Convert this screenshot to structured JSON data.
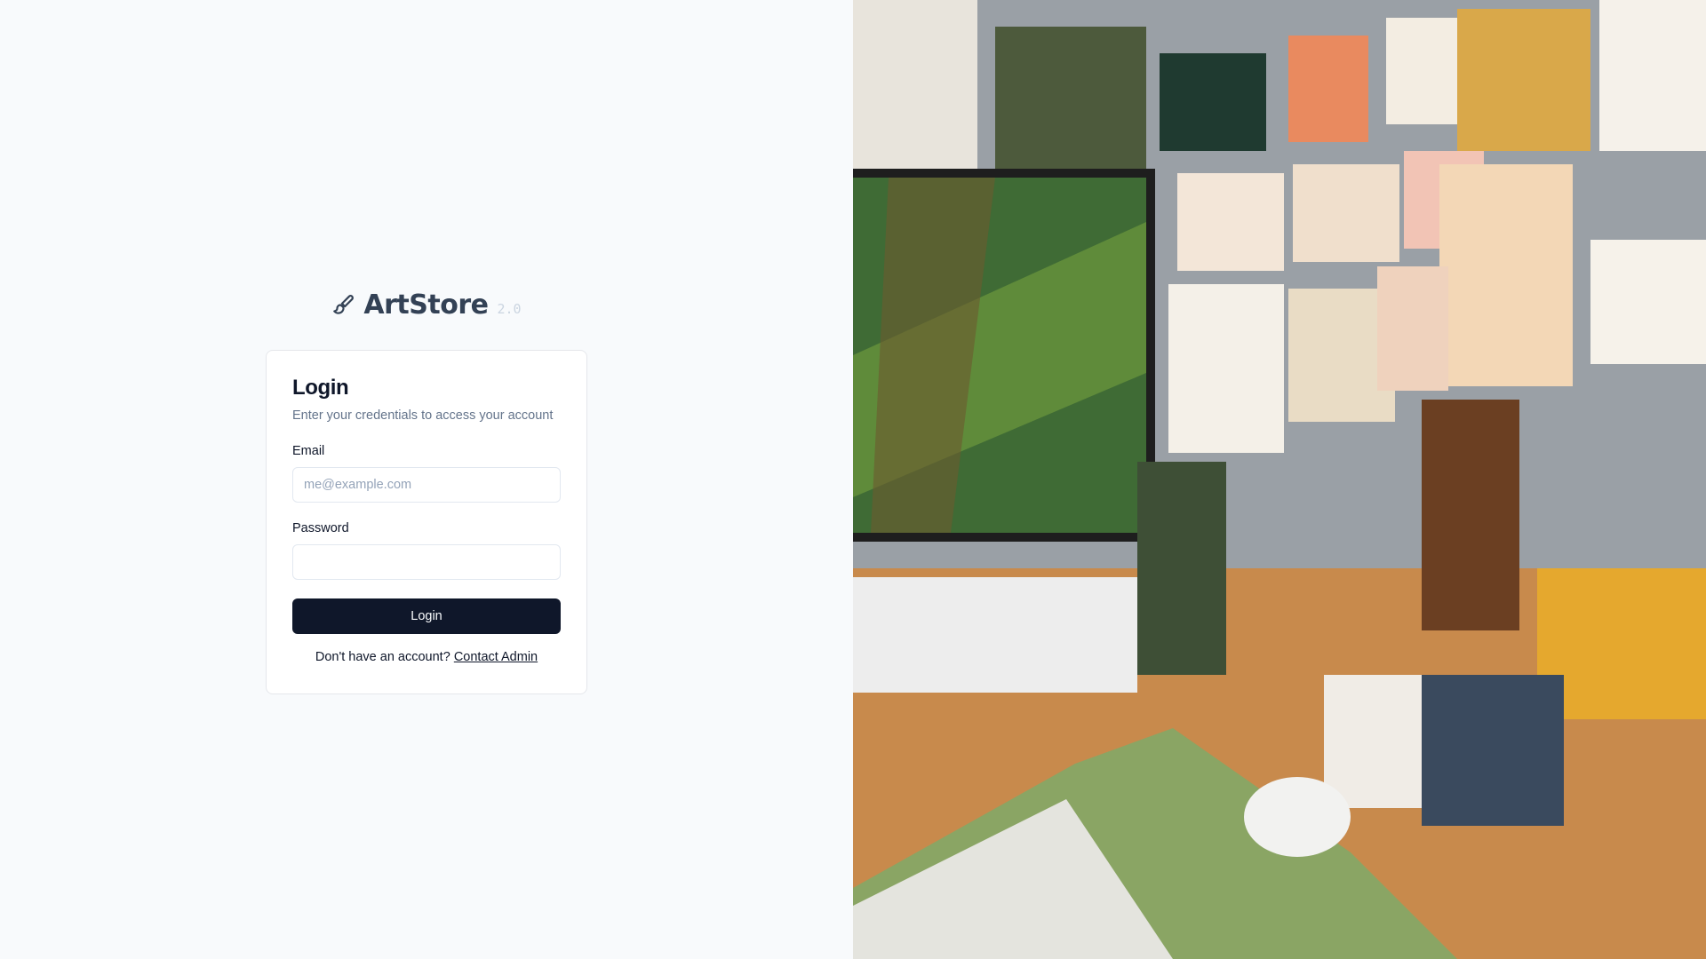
{
  "brand": {
    "icon": "paintbrush-icon",
    "name": "ArtStore",
    "version": "2.0"
  },
  "login_card": {
    "title": "Login",
    "subtitle": "Enter your credentials to access your account",
    "email_label": "Email",
    "email_placeholder": "me@example.com",
    "email_value": "",
    "password_label": "Password",
    "password_value": "",
    "submit_label": "Login",
    "signup_prompt": "Don't have an account?",
    "signup_link": "Contact Admin"
  },
  "colors": {
    "page_background": "#f8fafc",
    "button_background": "#0f172a",
    "muted_text": "#64748b",
    "border": "#e5e7eb"
  }
}
